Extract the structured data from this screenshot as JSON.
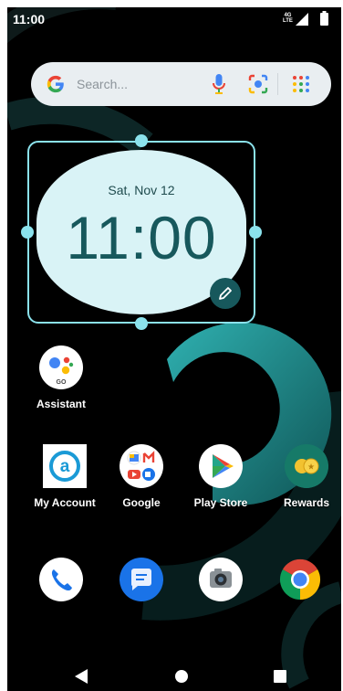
{
  "status_bar": {
    "time": "11:00",
    "network_top": "4G",
    "network_bottom": "LTE"
  },
  "search_bar": {
    "placeholder": "Search..."
  },
  "clock_widget": {
    "date": "Sat, Nov 12",
    "time": "11:00"
  },
  "apps": {
    "assistant": "Assistant",
    "assistant_badge": "GO",
    "my_account": "My Account",
    "google": "Google",
    "play_store": "Play Store",
    "rewards": "Rewards"
  },
  "dock": [
    "phone-icon",
    "messages-icon",
    "camera-icon",
    "chrome-icon"
  ],
  "navigation": [
    "back-button",
    "home-button",
    "recents-button"
  ],
  "colors": {
    "accent": "#17585c",
    "widget_bg": "#d9f3f6",
    "handle": "#8be2ec",
    "wallpaper_teal": "#2aa3a5"
  }
}
